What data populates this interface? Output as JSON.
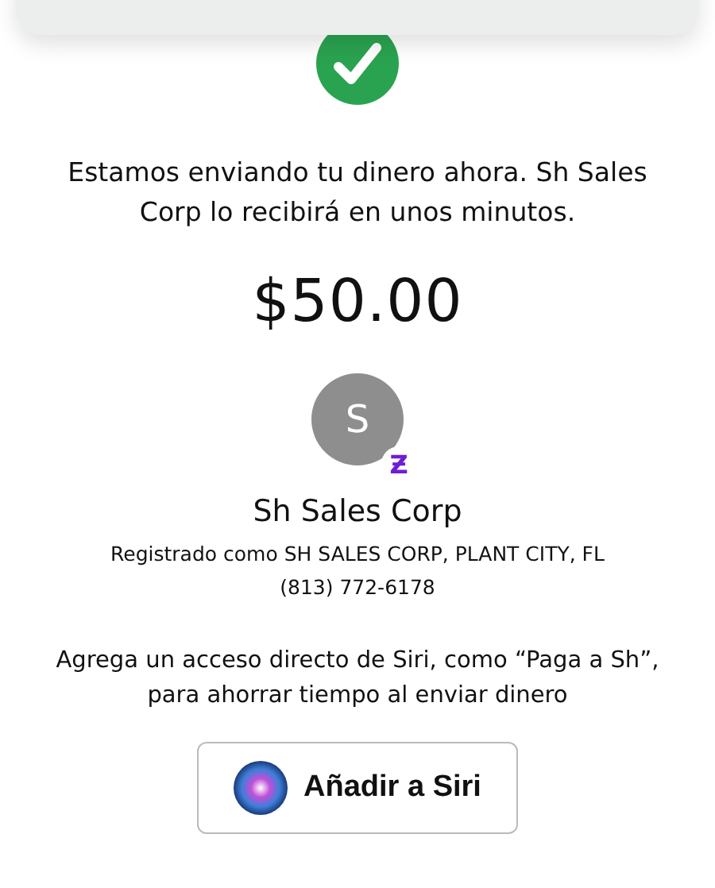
{
  "message": "Estamos enviando tu dinero ahora. Sh Sales Corp lo recibirá en unos minutos.",
  "amount": "$50.00",
  "recipient": {
    "initial": "S",
    "badge": "Ƶ",
    "name": "Sh Sales Corp",
    "registered": "Registrado como SH SALES CORP, PLANT CITY, FL",
    "phone": "(813) 772-6178"
  },
  "siri": {
    "hint": "Agrega un acceso directo de Siri, como “Paga a Sh”, para ahorrar tiempo al enviar dinero",
    "button": "Añadir a Siri"
  }
}
